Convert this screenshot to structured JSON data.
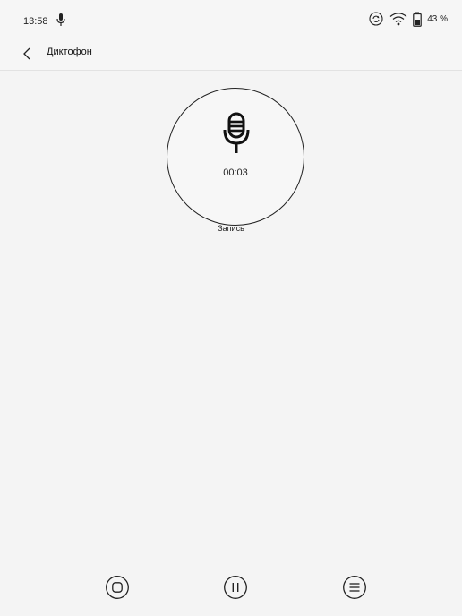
{
  "status_bar": {
    "time": "13:58",
    "battery_percent": "43 %",
    "icons": [
      "microphone-icon",
      "sync-icon",
      "wifi-icon",
      "battery-icon"
    ]
  },
  "header": {
    "title": "Диктофон",
    "back_icon": "chevron-left-icon"
  },
  "recorder": {
    "timer": "00:03",
    "status": "Запись",
    "icon": "studio-microphone-icon"
  },
  "controls": {
    "icons": [
      "stop-icon",
      "pause-icon",
      "list-icon"
    ]
  }
}
